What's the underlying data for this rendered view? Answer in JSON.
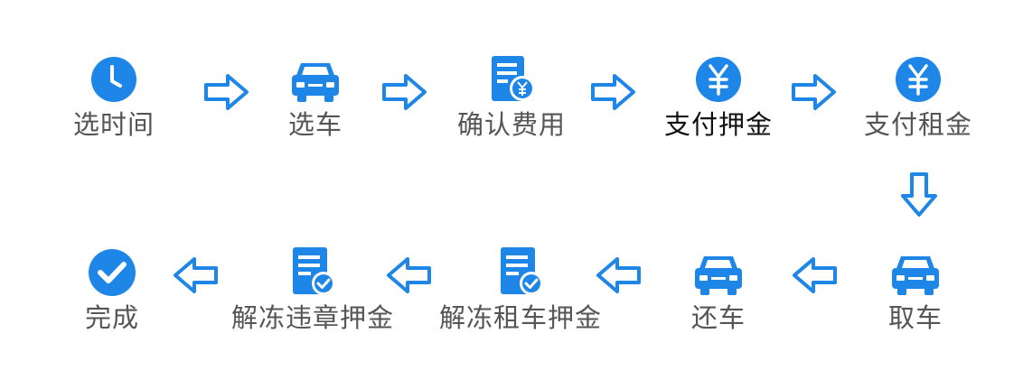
{
  "colors": {
    "primary": "#1E86E6",
    "primary_dark": "#1570C9",
    "label": "#555555",
    "label_highlight": "#111111"
  },
  "steps": [
    {
      "label": "选时间",
      "icon": "clock-icon"
    },
    {
      "label": "选车",
      "icon": "car-icon"
    },
    {
      "label": "确认费用",
      "icon": "bill-yuan-icon"
    },
    {
      "label": "支付押金",
      "icon": "yuan-coin-icon"
    },
    {
      "label": "支付租金",
      "icon": "yuan-coin-icon"
    },
    {
      "label": "取车",
      "icon": "car-icon"
    },
    {
      "label": "还车",
      "icon": "car-icon"
    },
    {
      "label": "解冻租车押金",
      "icon": "document-check-icon"
    },
    {
      "label": "解冻违章押金",
      "icon": "document-check-icon"
    },
    {
      "label": "完成",
      "icon": "check-circle-icon"
    }
  ]
}
